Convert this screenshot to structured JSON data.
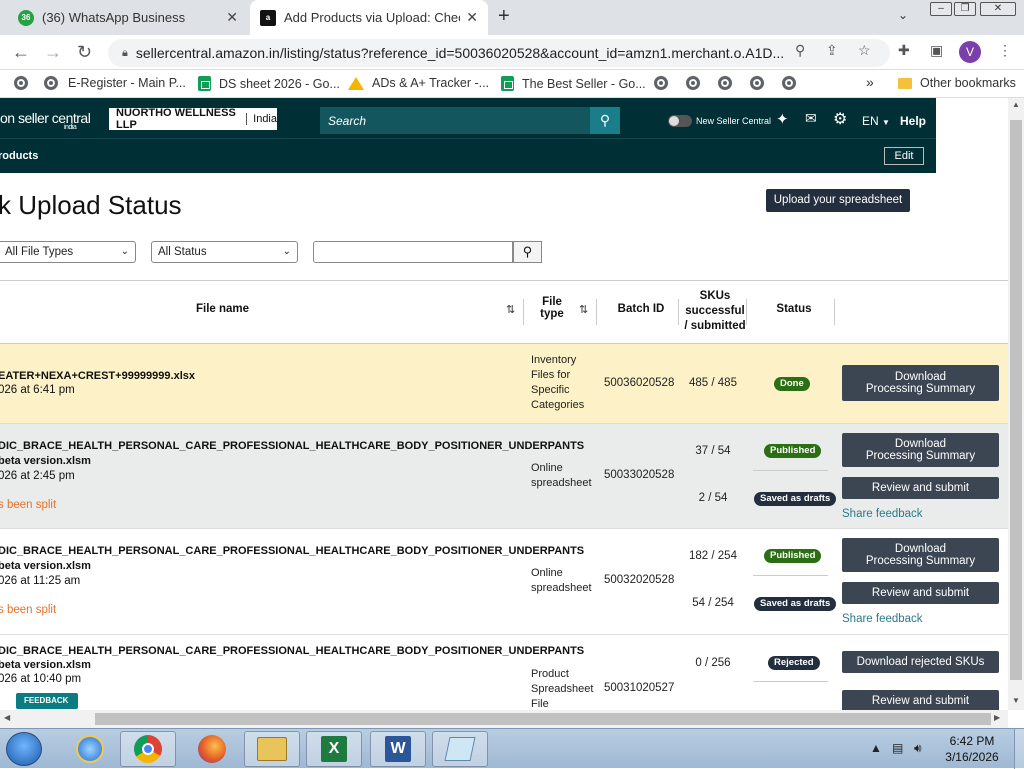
{
  "browser": {
    "tabs": [
      {
        "title": "(36) WhatsApp Business",
        "badge": "36",
        "close": "✕",
        "active": false,
        "icon_color": "#25a244"
      },
      {
        "title": "Add Products via Upload: Check",
        "badge": "a",
        "close": "✕",
        "active": true,
        "icon_color": "#111111"
      }
    ],
    "new_tab": "+",
    "url": "sellercentral.amazon.in/listing/status?reference_id=50036020528&account_id=amzn1.merchant.o.A1D...",
    "avatar_letter": "V",
    "bookmarks": [
      {
        "label": "E-Register - Main P...",
        "icon": "globe-icon"
      },
      {
        "label": "DS sheet 2026 - Go...",
        "icon": "sheets-icon"
      },
      {
        "label": "ADs & A+ Tracker -...",
        "icon": "drive-icon"
      },
      {
        "label": "The Best Seller - Go...",
        "icon": "sheets-icon"
      }
    ],
    "more_bookmarks": "»",
    "other_bookmarks": "Other bookmarks"
  },
  "seller_central": {
    "logo_text": "on seller central",
    "logo_sub": "india",
    "store_name": "NUORTHO WELLNESS LLP",
    "store_country": "India",
    "search_placeholder": "Search",
    "new_sc_label": "New Seller Central",
    "language": "EN",
    "help": "Help",
    "breadcrumb": "roducts",
    "edit": "Edit"
  },
  "page": {
    "title": "k Upload Status",
    "upload_button": "Upload your spreadsheet",
    "filter_file_types": "All File Types",
    "filter_status": "All Status",
    "search_value": "",
    "feedback": "FEEDBACK"
  },
  "table": {
    "headers": {
      "file_name": "File name",
      "file_type": "File type",
      "batch_id": "Batch ID",
      "skus": "SKUs successful / submitted",
      "status": "Status"
    },
    "rows": [
      {
        "name_line1": "EATER+NEXA+CREST+99999999.xlsx",
        "name_line2": "",
        "date": "026 at 6:41 pm",
        "note": "",
        "file_type": "Inventory Files for Specific Categories",
        "batch_id": "50036020528",
        "sku1": "485 / 485",
        "status1": "Done",
        "sku2": "",
        "status2": "",
        "action1": "Download Processing Summary",
        "action2": "",
        "share": ""
      },
      {
        "name_line1": "DIC_BRACE_HEALTH_PERSONAL_CARE_PROFESSIONAL_HEALTHCARE_BODY_POSITIONER_UNDERPANTS",
        "name_line2": " beta version.xlsm",
        "date": "026 at 2:45 pm",
        "note": "s been split",
        "file_type": "Online spreadsheet",
        "batch_id": "50033020528",
        "sku1": "37 / 54",
        "status1": "Published",
        "sku2": "2 / 54",
        "status2": "Saved as drafts",
        "action1": "Download Processing Summary",
        "action2": "Review and submit",
        "share": "Share feedback"
      },
      {
        "name_line1": "DIC_BRACE_HEALTH_PERSONAL_CARE_PROFESSIONAL_HEALTHCARE_BODY_POSITIONER_UNDERPANTS",
        "name_line2": " beta version.xlsm",
        "date": "026 at 11:25 am",
        "note": "s been split",
        "file_type": "Online spreadsheet",
        "batch_id": "50032020528",
        "sku1": "182 / 254",
        "status1": "Published",
        "sku2": "54 / 254",
        "status2": "Saved as drafts",
        "action1": "Download Processing Summary",
        "action2": "Review and submit",
        "share": "Share feedback"
      },
      {
        "name_line1": "DIC_BRACE_HEALTH_PERSONAL_CARE_PROFESSIONAL_HEALTHCARE_BODY_POSITIONER_UNDERPANTS",
        "name_line2": " beta version.xlsm",
        "date": "026 at 10:40 pm",
        "note": "",
        "file_type": "Product Spreadsheet File",
        "batch_id": "50031020527",
        "sku1": "0 / 256",
        "status1": "Rejected",
        "sku2": "",
        "status2": "",
        "action1": "Download rejected SKUs",
        "action2": "Review and submit",
        "share": ""
      }
    ]
  },
  "taskbar": {
    "time": "6:42 PM",
    "date": "3/16/2026",
    "apps": [
      "internet-explorer-icon",
      "chrome-icon",
      "firefox-icon",
      "file-explorer-icon",
      "excel-icon",
      "word-icon",
      "notepad-icon"
    ]
  }
}
